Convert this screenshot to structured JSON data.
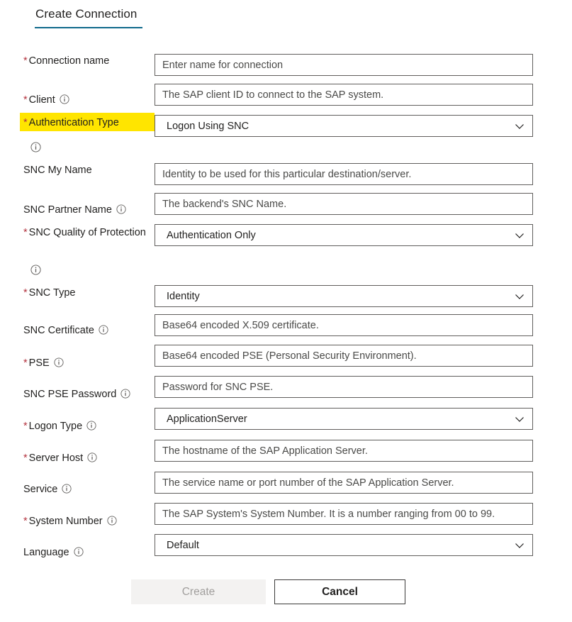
{
  "header": {
    "tab_label": "Create Connection"
  },
  "icons": {
    "info": "info-icon",
    "chevron": "chevron-down-icon"
  },
  "colors": {
    "required_asterisk": "#b4333f",
    "tab_underline": "#0f6a8b",
    "highlight": "#ffe500",
    "field_border": "#605e5c",
    "placeholder_text": "#4a4a48"
  },
  "fields": [
    {
      "label": "Connection name",
      "required": true,
      "has_info": false,
      "type": "text",
      "placeholder": "Enter name for connection",
      "highlighted": false
    },
    {
      "label": "Client",
      "required": true,
      "has_info": true,
      "type": "text",
      "placeholder": "The SAP client ID to connect to the SAP system.",
      "highlighted": false
    },
    {
      "label": "Authentication Type",
      "required": true,
      "has_info": true,
      "info_below": true,
      "type": "dropdown",
      "value": "Logon Using SNC",
      "highlighted": true
    },
    {
      "label": "SNC My Name",
      "required": false,
      "has_info": false,
      "type": "text",
      "placeholder": "Identity to be used for this particular destination/server.",
      "highlighted": false
    },
    {
      "label": "SNC Partner Name",
      "required": false,
      "has_info": true,
      "type": "text",
      "placeholder": "The backend's SNC Name.",
      "highlighted": false
    },
    {
      "label": "SNC Quality of Protection",
      "required": true,
      "has_info": true,
      "info_below": true,
      "type": "dropdown",
      "value": "Authentication Only",
      "highlighted": false
    },
    {
      "label": "SNC Type",
      "required": true,
      "has_info": false,
      "type": "dropdown",
      "value": "Identity",
      "highlighted": false
    },
    {
      "label": "SNC Certificate",
      "required": false,
      "has_info": true,
      "type": "text",
      "placeholder": "Base64 encoded X.509 certificate.",
      "highlighted": false
    },
    {
      "label": "PSE",
      "required": true,
      "has_info": true,
      "type": "text",
      "placeholder": "Base64 encoded PSE (Personal Security Environment).",
      "highlighted": false
    },
    {
      "label": "SNC PSE Password",
      "required": false,
      "has_info": true,
      "type": "text",
      "placeholder": "Password for SNC PSE.",
      "highlighted": false
    },
    {
      "label": "Logon Type",
      "required": true,
      "has_info": true,
      "type": "dropdown",
      "value": "ApplicationServer",
      "highlighted": false
    },
    {
      "label": "Server Host",
      "required": true,
      "has_info": true,
      "type": "text",
      "placeholder": "The hostname of the SAP Application Server.",
      "highlighted": false
    },
    {
      "label": "Service",
      "required": false,
      "has_info": true,
      "type": "text",
      "placeholder": "The service name or port number of the SAP Application Server.",
      "highlighted": false
    },
    {
      "label": "System Number",
      "required": true,
      "has_info": true,
      "type": "text",
      "placeholder": "The SAP System's System Number. It is a number ranging from 00 to 99.",
      "highlighted": false
    },
    {
      "label": "Language",
      "required": false,
      "has_info": true,
      "type": "dropdown",
      "value": "Default",
      "highlighted": false
    }
  ],
  "buttons": {
    "create": "Create",
    "cancel": "Cancel"
  }
}
